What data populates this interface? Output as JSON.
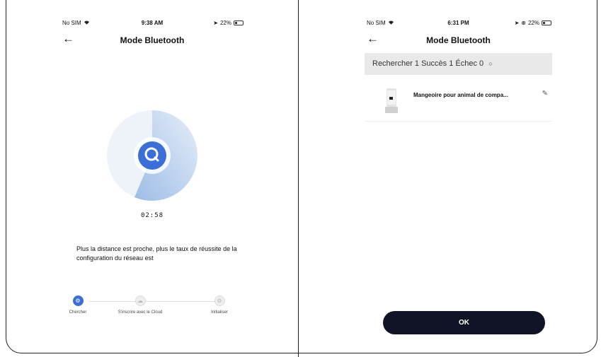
{
  "left_screen": {
    "status": {
      "carrier": "No SIM",
      "time": "9:38 AM",
      "battery": "22%"
    },
    "title": "Mode Bluetooth",
    "timer": "02:58",
    "description": "Plus la distance est proche, plus le taux de réussite de la configuration du réseau est",
    "steps": [
      {
        "label": "Chercher",
        "icon": "search-step-icon"
      },
      {
        "label": "S'inscrire avec le Cloud",
        "icon": "cloud-step-icon"
      },
      {
        "label": "Initialiser",
        "icon": "init-step-icon"
      }
    ]
  },
  "right_screen": {
    "status": {
      "carrier": "No SIM",
      "time": "6:31 PM",
      "battery": "22%"
    },
    "title": "Mode Bluetooth",
    "search_status": "Rechercher 1 Succès 1 Échec 0",
    "device": {
      "name": "Mangeoire pour  animal de compa...",
      "icon": "pet-feeder-icon"
    },
    "ok_label": "OK"
  },
  "colors": {
    "accent": "#3a6fd8",
    "button": "#111427",
    "search_bar_bg": "#e9e9e9"
  }
}
